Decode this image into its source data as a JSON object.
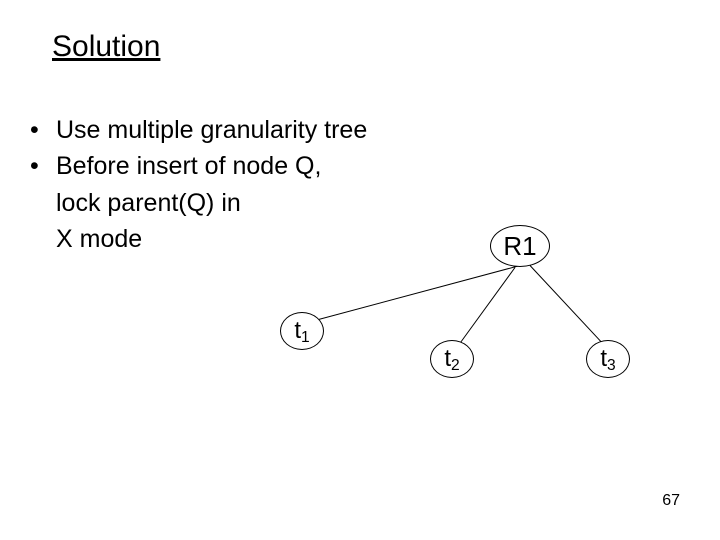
{
  "title": "Solution",
  "bullets": {
    "b1": "Use multiple granularity tree",
    "b2": "Before insert of node Q,",
    "b2_cont1": "lock parent(Q) in",
    "b2_cont2": "X mode"
  },
  "nodes": {
    "r1": "R1",
    "t_prefix": "t",
    "t1_sub": "1",
    "t2_sub": "2",
    "t3_sub": "3"
  },
  "page_number": "67",
  "chart_data": {
    "type": "tree",
    "root": "R1",
    "children": [
      "t1",
      "t2",
      "t3"
    ],
    "description": "Multiple granularity tree with root R1 and three child leaf nodes t1, t2, t3"
  }
}
